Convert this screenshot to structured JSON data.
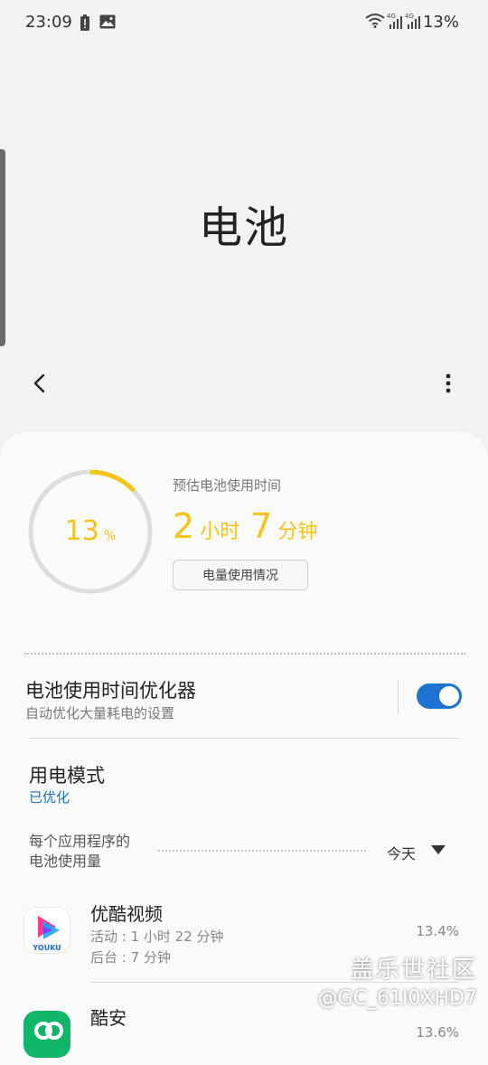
{
  "status_bar": {
    "time": "23:09",
    "battery_percent": "13%",
    "network_labels": [
      "4G",
      "4G"
    ]
  },
  "header": {
    "title": "电池"
  },
  "battery": {
    "level_percent": 13,
    "level_number": "13",
    "level_unit": "%",
    "estimate_label": "预估电池使用时间",
    "estimate_hours": "2",
    "estimate_hours_unit": "小时",
    "estimate_minutes": "7",
    "estimate_minutes_unit": "分钟",
    "usage_button": "电量使用情况",
    "ring_color": "#f4c419"
  },
  "optimizer": {
    "title": "电池使用时间优化器",
    "subtitle": "自动优化大量耗电的设置",
    "enabled": true
  },
  "power_mode": {
    "title": "用电模式",
    "value": "已优化"
  },
  "per_app": {
    "label_line1": "每个应用程序的",
    "label_line2": "电池使用量",
    "period": "今天"
  },
  "apps": [
    {
      "name": "优酷视频",
      "icon_text": "YOUKU",
      "active": "活动 : 1 小时 22 分钟",
      "background": "后台 : 7 分钟",
      "percent": "13.4%"
    },
    {
      "name": "酷安",
      "icon_text": "",
      "percent": "13.6%"
    }
  ],
  "watermark": {
    "line1": "盖乐世社区",
    "line2": "@GC_61I0XHD7"
  },
  "colors": {
    "accent_yellow": "#f4c419",
    "toggle_blue": "#1e73d2",
    "link_blue": "#1d73b8"
  }
}
